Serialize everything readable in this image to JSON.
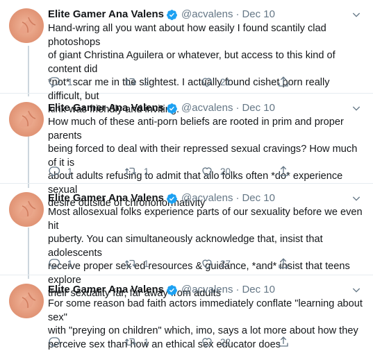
{
  "author": {
    "name": "Elite Gamer Ana Valens",
    "handle": "@acvalens",
    "verified": true
  },
  "tweets": [
    {
      "date": "Dec 10",
      "text": "Hand-wring all you want about how easily I found scantily clad photoshops\nof giant Christina Aguilera or whatever, but access to this kind of content did\n*not* scar me in the slightest. I actually found cishet porn really difficult, but\nkink was friendly and inviting.",
      "replies": "1",
      "retweets": "2",
      "likes": "21"
    },
    {
      "date": "Dec 10",
      "text": "How much of these anti-porn beliefs are rooted in prim and proper parents\nbeing forced to deal with their repressed sexual cravings? How much of it is\nabout adults refusing to admit that allo folks often *do* experience sexual\ndesire outside of chrononormativity",
      "replies": "1",
      "retweets": "1",
      "likes": "20"
    },
    {
      "date": "Dec 10",
      "text": "Most allosexual folks experience parts of our sexuality before we even hit\npuberty. You can simultaneously acknowledge that, insist that adolescents\nreceive proper sex ed resources & guidance, *and* insist that teens explore\ntheir sexuality far, far away from adults",
      "replies": "1",
      "retweets": "1",
      "likes": "27"
    },
    {
      "date": "Dec 10",
      "text": "For some reason bad faith actors immediately conflate \"learning about sex\"\nwith \"preying on children\" which, imo, says a lot more about how they\nperceive sex than how an ethical sex educator does",
      "replies": "",
      "retweets": "1",
      "likes": "22"
    }
  ],
  "colors": {
    "text": "#14171a",
    "secondary": "#657786",
    "verified": "#1da1f2",
    "divider": "#e6ecf0",
    "thread": "#ccd6dd"
  },
  "icons": [
    "reply-icon",
    "retweet-icon",
    "like-icon",
    "share-icon",
    "verified-badge-icon",
    "caret-down-icon"
  ]
}
